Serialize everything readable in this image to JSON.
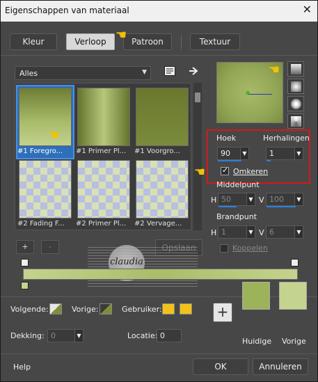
{
  "window": {
    "title": "Eigenschappen van materiaal",
    "close_glyph": "✕"
  },
  "tabs": [
    {
      "label": "Kleur",
      "active": false
    },
    {
      "label": "Verloop",
      "active": true
    },
    {
      "label": "Patroon",
      "active": false
    },
    {
      "label": "Textuur",
      "active": false
    }
  ],
  "category": {
    "value": "Alles"
  },
  "gallery": {
    "items": [
      {
        "label": "#1 Foregro...",
        "style": "g1",
        "selected": true
      },
      {
        "label": "#1 Primer Pl...",
        "style": "g2",
        "selected": false
      },
      {
        "label": "#1 Voorgro...",
        "style": "g3",
        "selected": false
      },
      {
        "label": "#2 Fading F...",
        "style": "chk",
        "selected": false
      },
      {
        "label": "#2 Primer Pl...",
        "style": "chk",
        "selected": false
      },
      {
        "label": "#2 Vervage...",
        "style": "chk",
        "selected": false
      }
    ],
    "add_label": "+",
    "remove_label": "-",
    "save_label": "Opslaan"
  },
  "style_options": {
    "glyphs": [
      "▮",
      "▣",
      "◎",
      "◩"
    ]
  },
  "angle": {
    "label": "Hoek",
    "value": "90"
  },
  "repeats": {
    "label": "Herhalingen",
    "value": "1"
  },
  "invert": {
    "label": "Omkeren",
    "checked": true
  },
  "center": {
    "label": "Middelpunt",
    "h_label": "H",
    "h_value": "50",
    "v_label": "V",
    "v_value": "100"
  },
  "focal": {
    "label": "Brandpunt",
    "h_label": "H",
    "h_value": "1",
    "v_label": "V",
    "v_value": "6"
  },
  "link": {
    "label": "Koppelen",
    "checked": false
  },
  "watermark": {
    "text": "claudia"
  },
  "colors": {
    "following_label": "Volgende:",
    "previous_label": "Vorige:",
    "user_label": "Gebruiker:",
    "user_color_1": "#f2c21a",
    "user_color_2": "#f2c21a",
    "opacity_label": "Dekking:",
    "opacity_value": "0",
    "location_label": "Locatie:",
    "location_value": "0",
    "plus_label": "+",
    "current_label": "Huidige",
    "previous_swatch_label": "Vorige",
    "current_color": "#9db35a",
    "previous_color": "#c4d38d"
  },
  "footer": {
    "help": "Help",
    "ok": "OK",
    "cancel": "Annuleren"
  }
}
